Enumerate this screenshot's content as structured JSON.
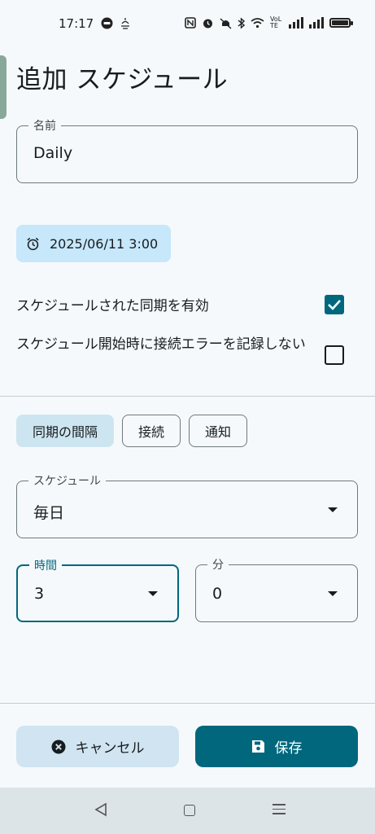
{
  "status_bar": {
    "time": "17:17",
    "left_icons": [
      "line-icon",
      "notification-icon"
    ],
    "right_icons": [
      "nfc-icon",
      "alarm-icon",
      "mute-icon",
      "bluetooth-icon",
      "wifi-icon",
      "volte-icon",
      "signal-icon",
      "signal-icon",
      "battery-icon"
    ],
    "volte_text": "VoLTE"
  },
  "page": {
    "title": "追加 スケジュール"
  },
  "name_field": {
    "label": "名前",
    "value": "Daily"
  },
  "date_chip": {
    "icon": "alarm-icon",
    "value": "2025/06/11 3:00"
  },
  "options": [
    {
      "label": "スケジュールされた同期を有効",
      "checked": true
    },
    {
      "label": "スケジュール開始時に接続エラーを記録しない",
      "checked": false
    }
  ],
  "tabs": [
    {
      "label": "同期の間隔",
      "selected": true
    },
    {
      "label": "接続",
      "selected": false
    },
    {
      "label": "通知",
      "selected": false
    }
  ],
  "schedule_field": {
    "label": "スケジュール",
    "value": "毎日"
  },
  "hour_field": {
    "label": "時間",
    "value": "3"
  },
  "minute_field": {
    "label": "分",
    "value": "0"
  },
  "buttons": {
    "cancel": {
      "label": "キャンセル",
      "icon": "cancel-circle-icon"
    },
    "save": {
      "label": "保存",
      "icon": "save-icon"
    }
  },
  "colors": {
    "primary": "#00677d",
    "chip_bg": "#c7e7fb",
    "selected_tab_bg": "#cde5f0",
    "cancel_bg": "#d0e4f1",
    "background": "#f6f9fb"
  }
}
